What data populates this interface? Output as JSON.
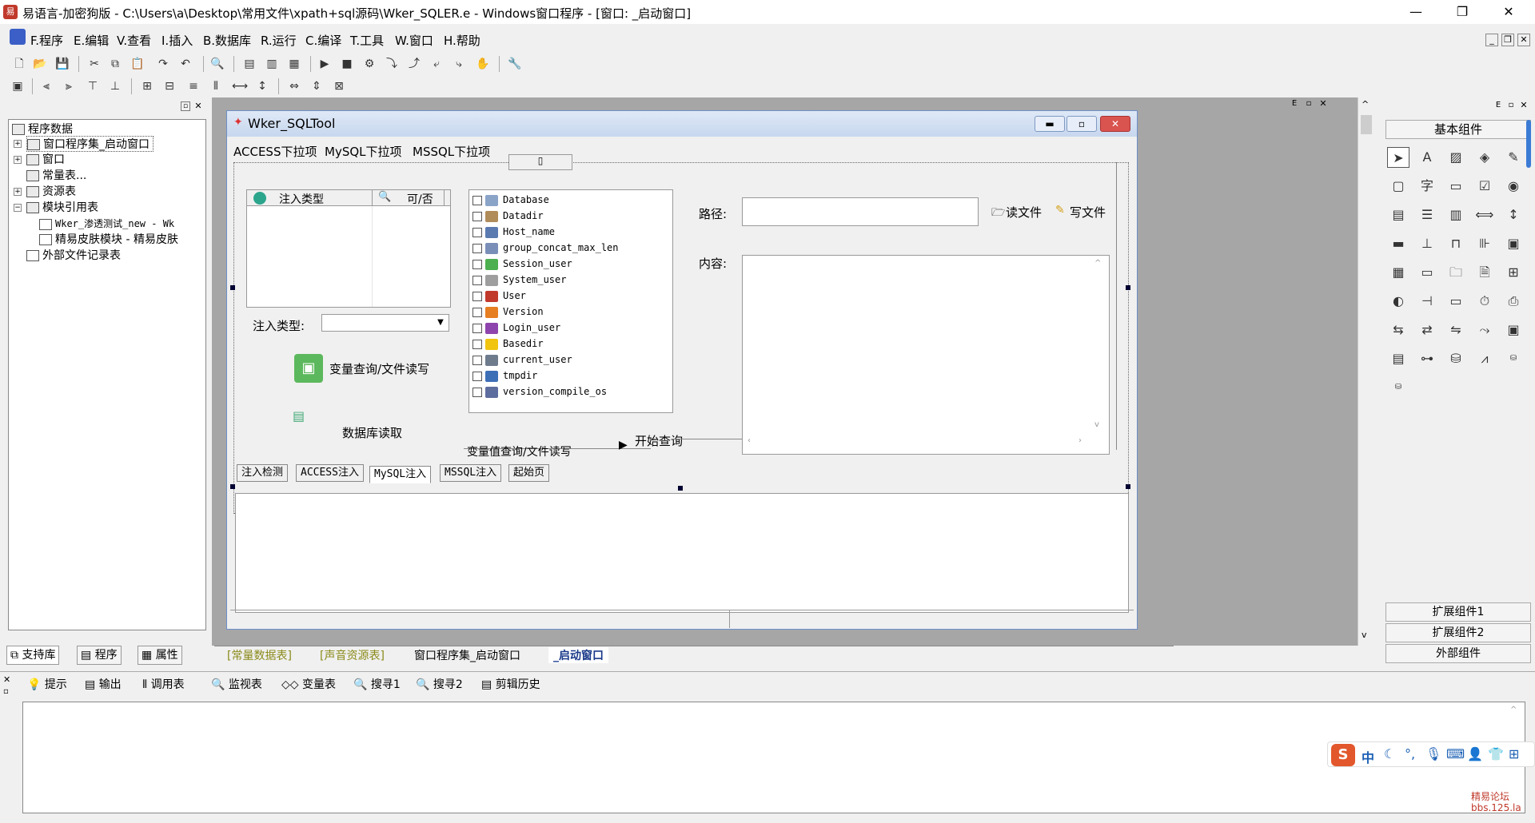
{
  "window": {
    "title": "易语言-加密狗版 - C:\\Users\\a\\Desktop\\常用文件\\xpath+sql源码\\Wker_SQLER.e - Windows窗口程序 - [窗口: _启动窗口]",
    "min": "—",
    "max": "❐",
    "close": "✕"
  },
  "menubar": {
    "items": [
      "F.程序",
      "E.编辑",
      "V.查看",
      "I.插入",
      "B.数据库",
      "R.运行",
      "C.编译",
      "T.工具",
      "W.窗口",
      "H.帮助"
    ]
  },
  "tree": {
    "root": "程序数据",
    "items": [
      "窗口程序集_启动窗口",
      "窗口",
      "常量表...",
      "资源表",
      "模块引用表",
      "Wker_渗透测试_new - Wk",
      "精易皮肤模块 - 精易皮肤",
      "外部文件记录表"
    ]
  },
  "left_tabs": [
    "支持库",
    "程序",
    "属性"
  ],
  "form": {
    "title": "Wker_SQLTool",
    "menus": [
      "ACCESS下拉项",
      "MySQL下拉项",
      "MSSQL下拉项"
    ],
    "list_headers": [
      "注入类型",
      "可/否"
    ],
    "inject_type_label": "注入类型:",
    "var_query_button": "变量查询/文件读写",
    "db_read_button": "数据库读取",
    "checklist": [
      "Database",
      "Datadir",
      "Host_name",
      "group_concat_max_len",
      "Session_user",
      "System_user",
      "User",
      "Version",
      "Login_user",
      "Basedir",
      "current_user",
      "tmpdir",
      "version_compile_os"
    ],
    "path_label": "路径:",
    "read_file": "读文件",
    "write_file": "写文件",
    "content_label": "内容:",
    "var_query_group": "变量值查询/文件读写",
    "start_query": "开始查询",
    "tabs": [
      "注入检测",
      "ACCESS注入",
      "MySQL注入",
      "MSSQL注入",
      "起始页"
    ]
  },
  "editor_tabs": [
    "[常量数据表]",
    "[声音资源表]",
    "窗口程序集_启动窗口",
    "_启动窗口"
  ],
  "right_panel": {
    "title": "基本组件",
    "buttons": [
      "扩展组件1",
      "扩展组件2",
      "外部组件"
    ]
  },
  "bottom_tabs": [
    "提示",
    "输出",
    "调用表",
    "监视表",
    "变量表",
    "搜寻1",
    "搜寻2",
    "剪辑历史"
  ],
  "ime": {
    "lang": "中"
  },
  "watermark": {
    "line1": "精易论坛",
    "line2": "bbs.125.la"
  }
}
